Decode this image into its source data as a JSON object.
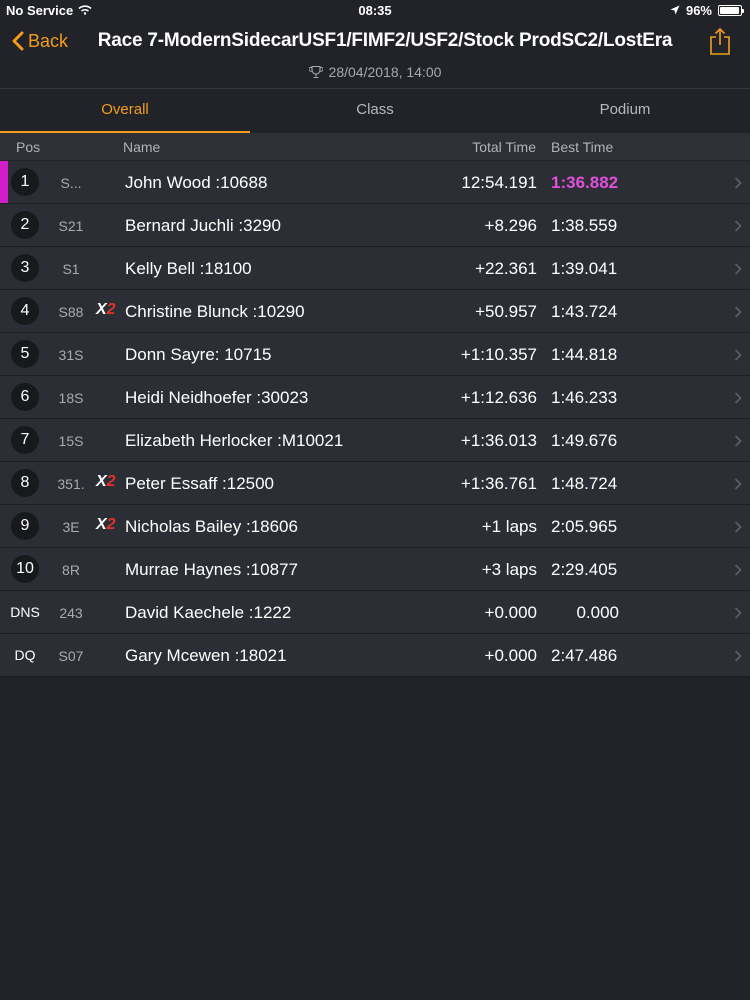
{
  "status_bar": {
    "carrier": "No Service",
    "time": "08:35",
    "battery": "96%",
    "battery_level": 0.96
  },
  "nav": {
    "back_label": "Back",
    "title": "Race 7-ModernSidecarUSF1/FIMF2/USF2/Stock ProdSC2/LostEra",
    "date": "28/04/2018, 14:00"
  },
  "tabs": [
    {
      "label": "Overall",
      "active": true
    },
    {
      "label": "Class",
      "active": false
    },
    {
      "label": "Podium",
      "active": false
    }
  ],
  "columns": {
    "pos": "Pos",
    "name": "Name",
    "total": "Total Time",
    "best": "Best Time"
  },
  "colors": {
    "accent": "#f39c1d",
    "leader_marker": "#d21ec9",
    "best_lap": "#e34fdd",
    "x2_red": "#e0332b"
  },
  "results": [
    {
      "pos": "1",
      "number": "S...",
      "flag": "",
      "name": "John Wood :10688",
      "total": "12:54.191",
      "best": "1:36.882",
      "leader": true,
      "fastest": true
    },
    {
      "pos": "2",
      "number": "S21",
      "flag": "",
      "name": "Bernard Juchli :3290",
      "total": "+8.296",
      "best": "1:38.559"
    },
    {
      "pos": "3",
      "number": "S1",
      "flag": "",
      "name": "Kelly Bell :18100",
      "total": "+22.361",
      "best": "1:39.041"
    },
    {
      "pos": "4",
      "number": "S88",
      "flag": "X2",
      "name": "Christine Blunck :10290",
      "total": "+50.957",
      "best": "1:43.724"
    },
    {
      "pos": "5",
      "number": "31S",
      "flag": "",
      "name": "Donn Sayre: 10715",
      "total": "+1:10.357",
      "best": "1:44.818"
    },
    {
      "pos": "6",
      "number": "18S",
      "flag": "",
      "name": "Heidi Neidhoefer :30023",
      "total": "+1:12.636",
      "best": "1:46.233"
    },
    {
      "pos": "7",
      "number": "15S",
      "flag": "",
      "name": "Elizabeth Herlocker :M10021",
      "total": "+1:36.013",
      "best": "1:49.676"
    },
    {
      "pos": "8",
      "number": "351.",
      "flag": "X2",
      "name": "Peter Essaff :12500",
      "total": "+1:36.761",
      "best": "1:48.724"
    },
    {
      "pos": "9",
      "number": "3E",
      "flag": "X2",
      "name": "Nicholas Bailey :18606",
      "total": "+1 laps",
      "best": "2:05.965"
    },
    {
      "pos": "10",
      "number": "8R",
      "flag": "",
      "name": "Murrae Haynes :10877",
      "total": "+3 laps",
      "best": "2:29.405"
    },
    {
      "pos": "DNS",
      "number": "243",
      "flag": "",
      "name": "David Kaechele :1222",
      "total": "+0.000",
      "best": "0.000"
    },
    {
      "pos": "DQ",
      "number": "S07",
      "flag": "",
      "name": "Gary Mcewen :18021",
      "total": "+0.000",
      "best": "2:47.486"
    }
  ]
}
